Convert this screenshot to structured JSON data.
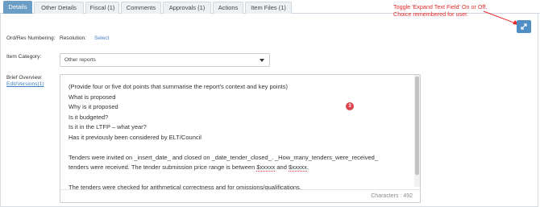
{
  "tabs": [
    {
      "label": "Details",
      "active": true
    },
    {
      "label": "Other Details"
    },
    {
      "label": "Fiscal (1)"
    },
    {
      "label": "Comments"
    },
    {
      "label": "Approvals (1)"
    },
    {
      "label": "Actions"
    },
    {
      "label": "Item Files (1)"
    }
  ],
  "annotation": {
    "line1": "Toggle 'Expand Text Field' On or Off.",
    "line2": "Choice remembered for user."
  },
  "form": {
    "ord_res_label": "Ord/Res Numbering:",
    "resolution_label": "Resolution:",
    "resolution_link": "Select",
    "item_category_label": "Item Category:",
    "item_category_value": "Other reports",
    "brief_overview_label": "Brief Overview:",
    "edit_versions_link": "Edit/Versions(1)"
  },
  "editor": {
    "lines": [
      "(Provide four or five dot points that summarise the report's context and key points)",
      "What is proposed",
      "Why is it proposed",
      "Is it budgeted?",
      "Is it in the LTFP – what year?",
      "Has it previously been considered by ELT/Council",
      "",
      "Tenders were invited on _insert_date_ and closed on _date_tender_closed_. _How_many_tenders_were_received_",
      "tenders were received. The tender submission price range is between",
      "",
      "The tenders were checked for arithmetical correctness and for omissions/qualifications."
    ],
    "spell_token_a": "$xxxxx",
    "and_word": "and",
    "spell_token_b": "$xxxxx",
    "period": ".",
    "character_count": "Characters : 492",
    "badge_count": "3"
  }
}
